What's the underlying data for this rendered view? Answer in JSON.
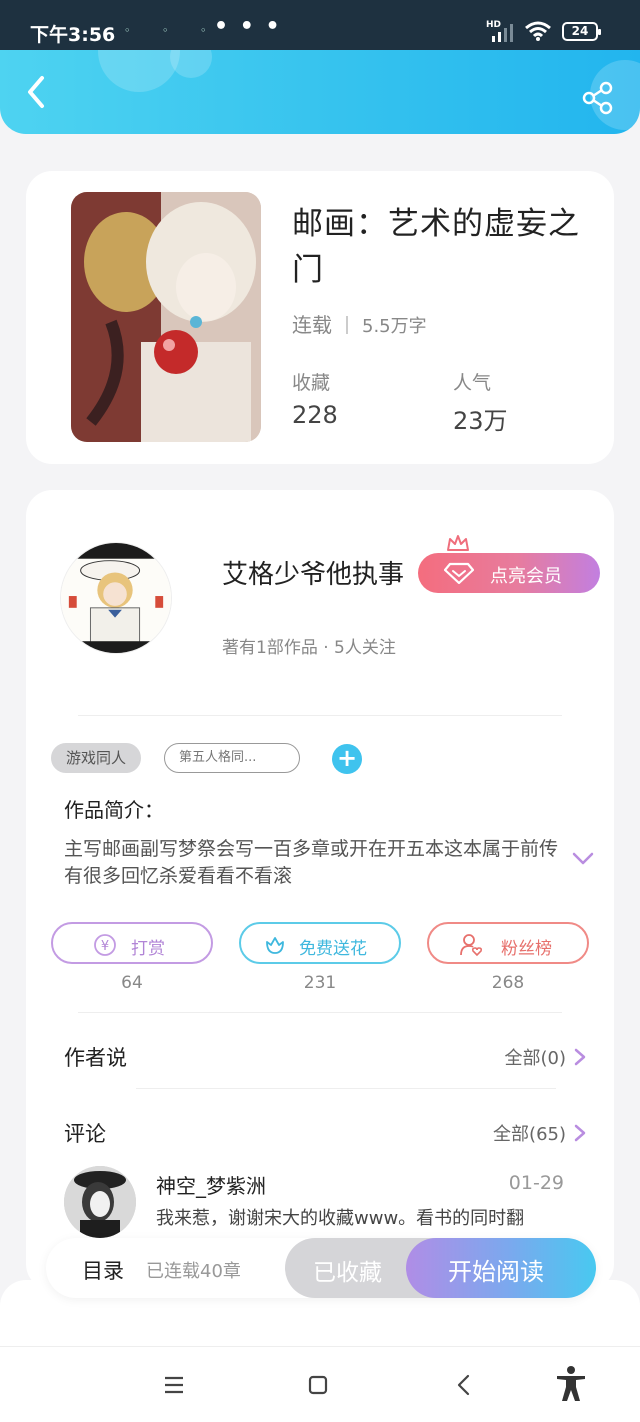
{
  "status_bar": {
    "time": "下午3:56",
    "notif_icons": "◦ ◦ ◦",
    "more": "• • •",
    "network": "HD",
    "battery": "24"
  },
  "header": {
    "back_icon": "chevron-left-icon",
    "share_icon": "share-icon"
  },
  "book": {
    "title": "邮画：艺术的虚妄之门",
    "status": "连载",
    "word_count": "5.5万字",
    "favorites_label": "收藏",
    "favorites_value": "228",
    "popularity_label": "人气",
    "popularity_value": "23万"
  },
  "author": {
    "name": "艾格少爷他执事",
    "vip_label": "点亮会员",
    "stats": "著有1部作品 · 5人关注"
  },
  "tags": [
    "游戏同人",
    "第五人格同..."
  ],
  "intro": {
    "title": "作品简介：",
    "text": "主写邮画副写梦祭会写一百多章或开在开五本这本属于前传有很多回忆杀爱看看不看滚"
  },
  "actions": [
    {
      "label": "打赏",
      "count": "64",
      "icon": "yen-coin-icon"
    },
    {
      "label": "免费送花",
      "count": "231",
      "icon": "flower-icon"
    },
    {
      "label": "粉丝榜",
      "count": "268",
      "icon": "fan-heart-icon"
    }
  ],
  "author_says": {
    "title": "作者说",
    "link": "全部(0)"
  },
  "comments": {
    "title": "评论",
    "link": "全部(65)",
    "first": {
      "name": "神空_梦紫洲",
      "date": "01-29",
      "text": "我来惹，谢谢宋大的收藏www。看书的同时翻"
    }
  },
  "read_bar": {
    "toc": "目录",
    "toc_sub": "已连载40章",
    "collected": "已收藏",
    "start": "开始阅读"
  },
  "colors": {
    "header": "#35c2ee",
    "accent_cyan": "#3fc3ee",
    "vip_start": "#f46d7e",
    "vip_end": "#c27fe0",
    "reward": "#b184d6",
    "flower": "#3fb8de",
    "fans": "#e7706c"
  }
}
